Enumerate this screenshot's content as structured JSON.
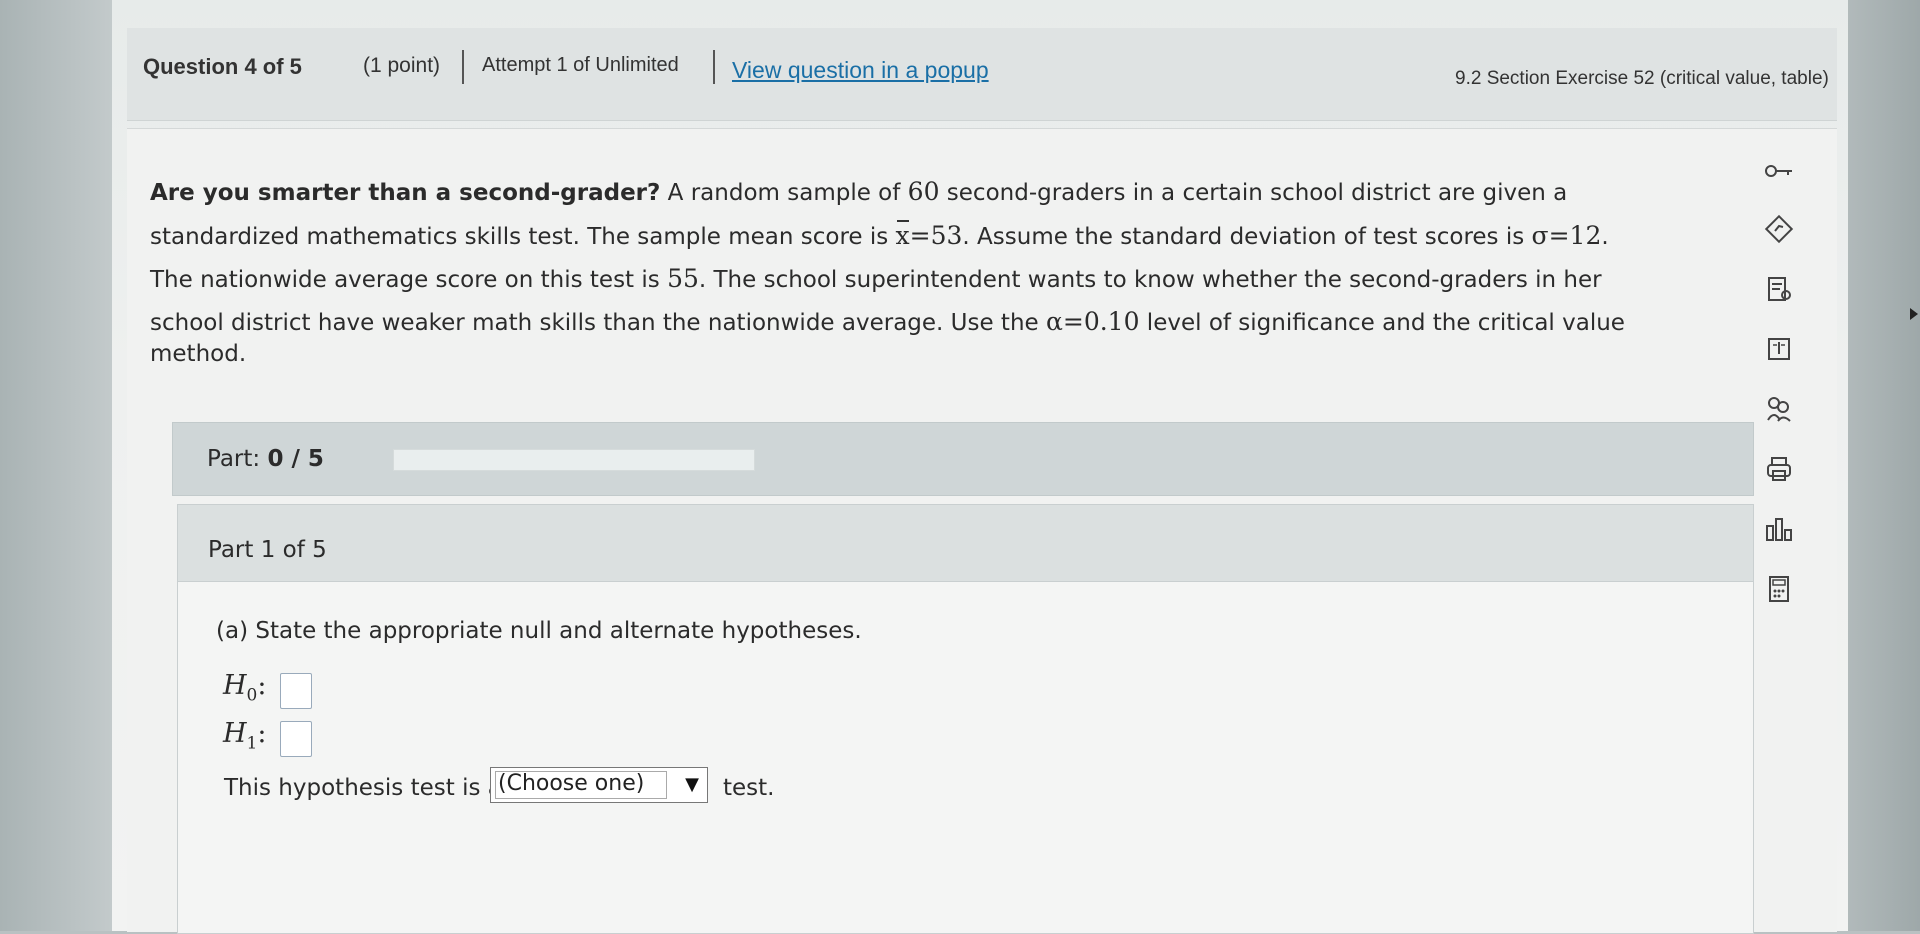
{
  "header": {
    "question_title": "Question 4 of 5",
    "points": "(1 point)",
    "attempt": "Attempt 1 of Unlimited",
    "popup_link": "View question in a popup",
    "section": "9.2 Section Exercise 52 (critical value, table)"
  },
  "problem": {
    "lead": "Are you smarter than a second-grader?",
    "l1_rest_a": " A random sample of ",
    "sample_n": "60",
    "l1_rest_b": " second-graders in a certain school district are given a",
    "l2_a": "standardized mathematics skills test. The sample mean score is ",
    "xbar_symbol": "x",
    "xbar_value": "=53",
    "l2_b": ". Assume the standard deviation of test scores is ",
    "sigma": "σ=12",
    "l2_c": ".",
    "l3_a": "The nationwide average score on this test is ",
    "mu": "55",
    "l3_b": ". The school superintendent wants to know whether the second-graders in her",
    "l4_a": "school district have weaker math skills than the nationwide average. Use the ",
    "alpha": "α=0.10",
    "l4_b": " level of significance and the critical value",
    "l5": "method."
  },
  "progress": {
    "label": "Part:",
    "value": "0 / 5",
    "fraction": 0
  },
  "part1": {
    "title": "Part 1 of 5",
    "instruction": "(a) State the appropriate null and alternate hypotheses.",
    "h0_label": "H",
    "h0_sub": "0",
    "h1_label": "H",
    "h1_sub": "1",
    "colon": ":",
    "test_prefix": "This hypothesis test is a",
    "select_value": "(Choose one)",
    "select_arrow": "▼",
    "test_suffix": "test."
  },
  "tools": [
    "key-icon",
    "answer-icon",
    "checklist-icon",
    "book-icon",
    "tutor-icon",
    "print-icon",
    "chart-icon",
    "calculator-icon"
  ]
}
